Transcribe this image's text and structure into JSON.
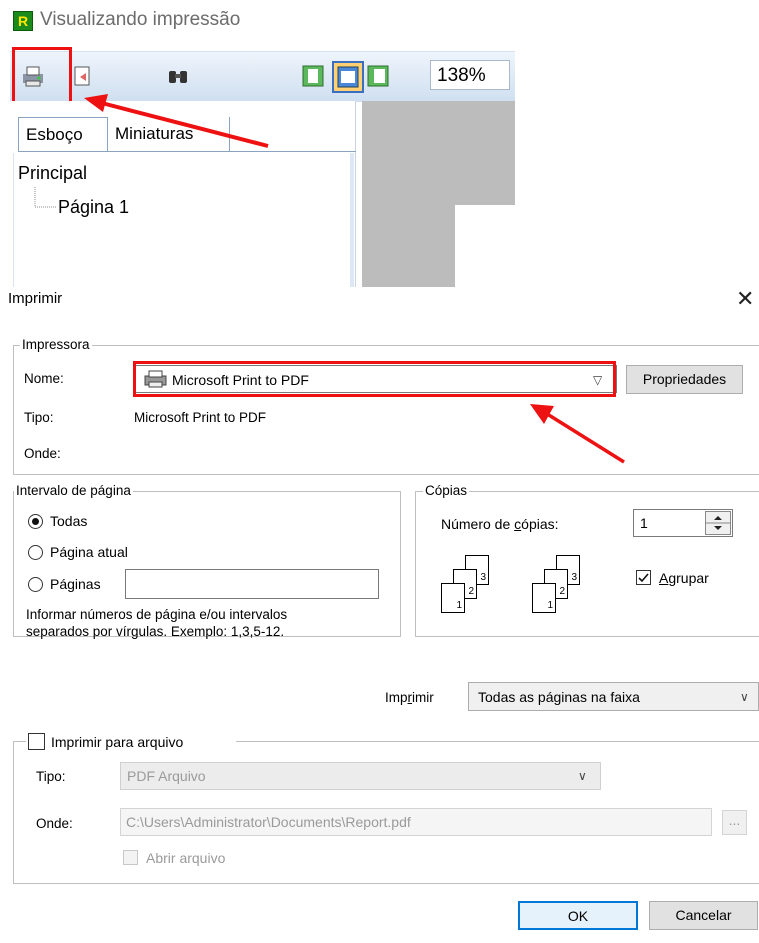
{
  "preview": {
    "logo_letter": "R",
    "title": "Visualizando impressão",
    "toolbar": {
      "zoom": "138%"
    },
    "tabs": [
      {
        "label": "Esboço"
      },
      {
        "label": "Miniaturas"
      }
    ],
    "outline": {
      "root": "Principal",
      "page": "Página 1"
    }
  },
  "dialog": {
    "title": "Imprimir",
    "close_glyph": "✕",
    "printer": {
      "group_label": "Impressora",
      "name_label": "Nome:",
      "name_value": "Microsoft Print to PDF",
      "properties_button": "Propriedades",
      "type_label": "Tipo:",
      "type_value": "Microsoft Print to PDF",
      "where_label": "Onde:"
    },
    "range": {
      "group_label": "Intervalo de página",
      "all": "Todas",
      "current": "Página atual",
      "pages": "Páginas",
      "hint_line1": "Informar números de página e/ou intervalos",
      "hint_line2": "separados por vírgulas. Exemplo: 1,3,5-12."
    },
    "copies": {
      "group_label": "Cópias",
      "count_label_pre": "Número de ",
      "count_label_u": "c",
      "count_label_post": "ópias:",
      "count_value": "1",
      "collate_u": "A",
      "collate_rest": "grupar",
      "page_numbers": [
        "1",
        "2",
        "3"
      ]
    },
    "print_select": {
      "label_pre": "Imp",
      "label_u": "r",
      "label_post": "imir",
      "value": "Todas as páginas na faixa"
    },
    "to_file": {
      "group_label": "Imprimir para arquivo",
      "type_label": "Tipo:",
      "type_value": "PDF Arquivo",
      "where_label": "Onde:",
      "where_value": "C:\\Users\\Administrator\\Documents\\Report.pdf",
      "browse": "...",
      "open_file": "Abrir arquivo"
    },
    "ok": "OK",
    "cancel": "Cancelar"
  },
  "colors": {
    "highlight": "#e11111",
    "toolbar_bg": "#cfdff0",
    "logo_bg": "#1a8a1a"
  }
}
